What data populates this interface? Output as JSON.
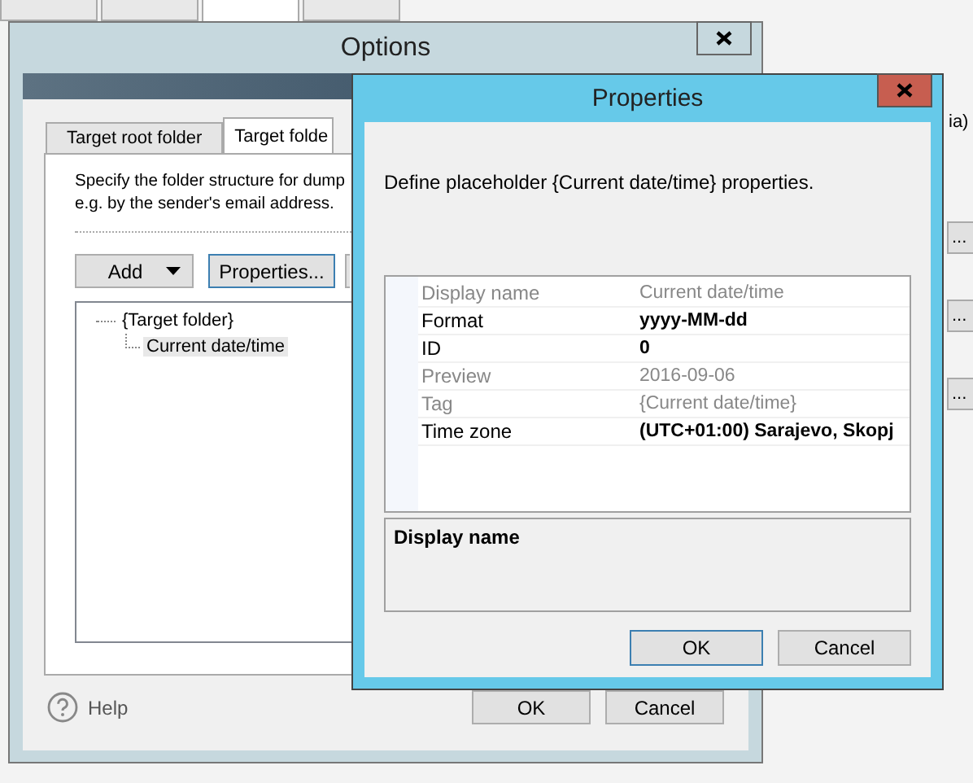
{
  "background_app": {
    "tabs": [
      {
        "selected": false
      },
      {
        "selected": false
      },
      {
        "selected": true
      },
      {
        "selected": false
      }
    ],
    "right_label": "ia)",
    "right_buttons": [
      "...",
      "...",
      "..."
    ]
  },
  "options_window": {
    "title": "Options",
    "tabs": [
      {
        "label": "Target root folder",
        "selected": false
      },
      {
        "label": "Target folde",
        "selected": true
      }
    ],
    "description": [
      "Specify the folder structure for dump",
      "e.g. by the sender's email address."
    ],
    "toolbar": [
      {
        "label": "Add",
        "kind": "dropdown"
      },
      {
        "label": "Properties...",
        "kind": "button"
      }
    ],
    "tree": [
      {
        "label": "{Target folder}",
        "selected": false,
        "children": [
          {
            "label": "Current date/time",
            "selected": true
          }
        ]
      }
    ],
    "help": "Help",
    "buttons": [
      "OK",
      "Cancel"
    ]
  },
  "properties_window": {
    "title": "Properties",
    "description": "Define placeholder {Current date/time} properties.",
    "grid": [
      {
        "name": "Display name",
        "value": "Current date/time",
        "editable": false
      },
      {
        "name": "Format",
        "value": "yyyy-MM-dd",
        "editable": true
      },
      {
        "name": "ID",
        "value": "0",
        "editable": true
      },
      {
        "name": "Preview",
        "value": "2016-09-06",
        "editable": false
      },
      {
        "name": "Tag",
        "value": "{Current date/time}",
        "editable": false
      },
      {
        "name": "Time zone",
        "value": "(UTC+01:00) Sarajevo, Skopj",
        "editable": true
      }
    ],
    "help_title": "Display name",
    "buttons": [
      "OK",
      "Cancel"
    ]
  }
}
